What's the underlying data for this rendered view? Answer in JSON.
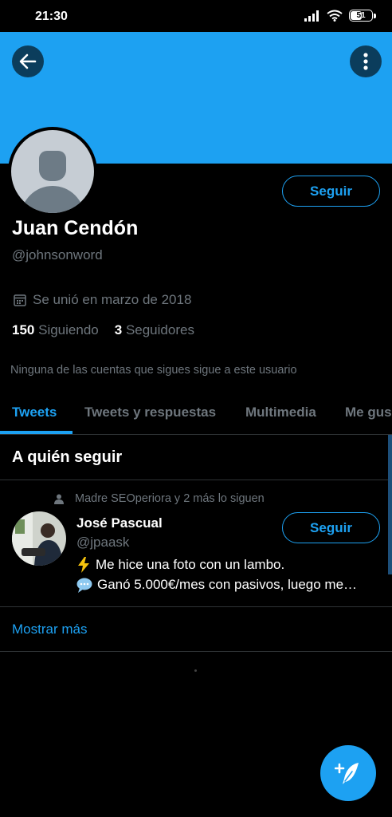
{
  "status_bar": {
    "time": "21:30",
    "battery": "51",
    "icons": [
      "signal-icon",
      "wifi-icon",
      "battery-icon"
    ]
  },
  "colors": {
    "accent": "#1da1f2",
    "background": "#000000",
    "muted_text": "#6e767d",
    "divider": "#2f3336"
  },
  "header": {
    "back_icon": "arrow-left-icon",
    "more_icon": "more-vertical-icon"
  },
  "profile": {
    "name": "Juan Cendón",
    "handle": "@johnsonword",
    "follow_label": "Seguir",
    "joined": "Se unió en marzo de 2018",
    "following_count": "150",
    "following_label": "Siguiendo",
    "followers_count": "3",
    "followers_label": "Seguidores",
    "mutuals_notice": "Ninguna de las cuentas que sigues sigue a este usuario"
  },
  "tabs": [
    {
      "label": "Tweets",
      "active": true
    },
    {
      "label": "Tweets y respuestas",
      "active": false
    },
    {
      "label": "Multimedia",
      "active": false
    },
    {
      "label": "Me gus",
      "active": false
    }
  ],
  "who_to_follow": {
    "title": "A quién seguir",
    "suggestion": {
      "context": "Madre SEOperiora y 2 más lo siguen",
      "name": "José Pascual",
      "handle": "@jpaask",
      "follow_label": "Seguir",
      "bio_line_1": "Me hice una foto con un lambo.",
      "bio_line_2": "Ganó 5.000€/mes con pasivos, luego me…"
    },
    "show_more": "Mostrar más"
  },
  "fab": {
    "icon": "compose-tweet-icon"
  }
}
